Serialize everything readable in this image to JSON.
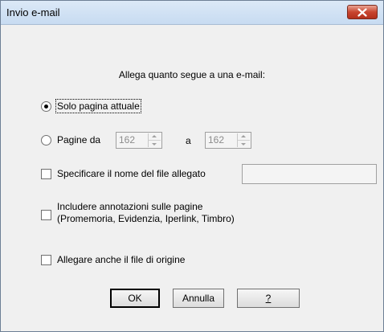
{
  "window": {
    "title": "Invio e-mail"
  },
  "heading": "Allega quanto segue a una e-mail:",
  "options": {
    "current_page": {
      "label": "Solo pagina attuale",
      "selected": true
    },
    "pages": {
      "label": "Pagine da",
      "from_value": "162",
      "to_label": "a",
      "to_value": "162",
      "selected": false
    },
    "filename": {
      "label": "Specificare il nome del file allegato",
      "value": ""
    },
    "annotations": {
      "label_line1": "Includere annotazioni sulle pagine",
      "label_line2": "(Promemoria, Evidenzia, Iperlink, Timbro)"
    },
    "attach_source": {
      "label": "Allegare anche il file di origine"
    }
  },
  "buttons": {
    "ok": "OK",
    "cancel": "Annulla",
    "help": "?"
  },
  "colors": {
    "close_button": "#c8452f",
    "titlebar": "#c7dbf1",
    "dialog_bg": "#f0f0f0"
  }
}
